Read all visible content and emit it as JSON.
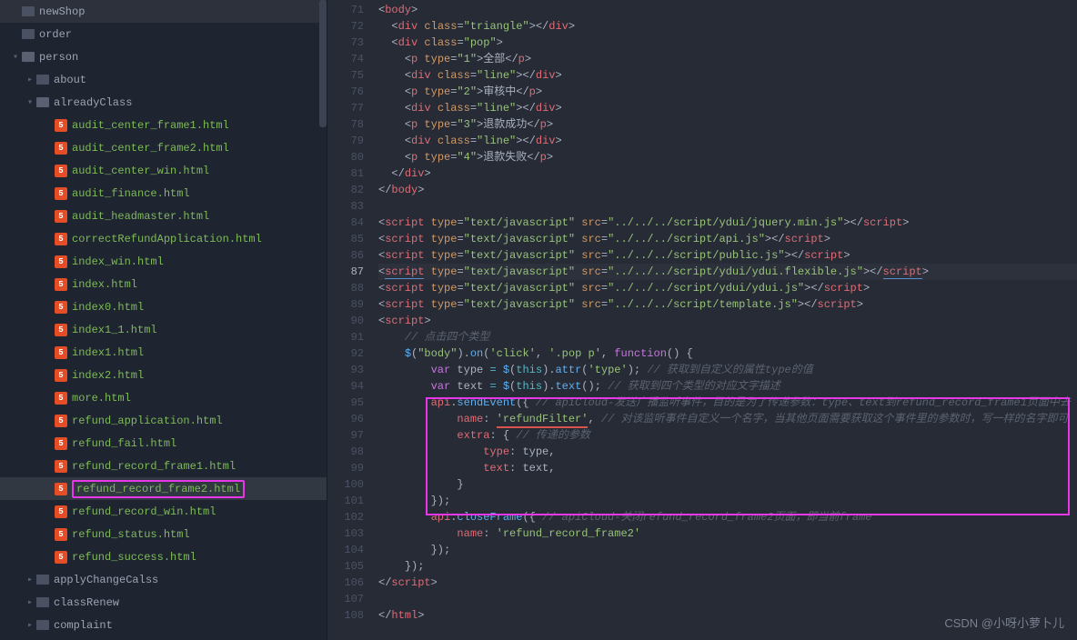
{
  "sidebar": {
    "items": [
      {
        "indent": 12,
        "chev": "",
        "icon": "folder",
        "label": "newShop",
        "class": ""
      },
      {
        "indent": 12,
        "chev": "",
        "icon": "folder",
        "label": "order",
        "class": ""
      },
      {
        "indent": 12,
        "chev": "▾",
        "icon": "folder-open",
        "label": "person",
        "class": ""
      },
      {
        "indent": 28,
        "chev": "▸",
        "icon": "folder",
        "label": "about",
        "class": ""
      },
      {
        "indent": 28,
        "chev": "▾",
        "icon": "folder-open",
        "label": "alreadyClass",
        "class": ""
      },
      {
        "indent": 48,
        "chev": "",
        "icon": "html",
        "label": "audit_center_frame1.html",
        "class": "green-name"
      },
      {
        "indent": 48,
        "chev": "",
        "icon": "html",
        "label": "audit_center_frame2.html",
        "class": "green-name"
      },
      {
        "indent": 48,
        "chev": "",
        "icon": "html",
        "label": "audit_center_win.html",
        "class": "green-name"
      },
      {
        "indent": 48,
        "chev": "",
        "icon": "html",
        "label": "audit_finance.html",
        "class": "green-name"
      },
      {
        "indent": 48,
        "chev": "",
        "icon": "html",
        "label": "audit_headmaster.html",
        "class": "green-name"
      },
      {
        "indent": 48,
        "chev": "",
        "icon": "html",
        "label": "correctRefundApplication.html",
        "class": "green-name"
      },
      {
        "indent": 48,
        "chev": "",
        "icon": "html",
        "label": "index_win.html",
        "class": "green-name"
      },
      {
        "indent": 48,
        "chev": "",
        "icon": "html",
        "label": "index.html",
        "class": "green-name"
      },
      {
        "indent": 48,
        "chev": "",
        "icon": "html",
        "label": "index0.html",
        "class": "green-name"
      },
      {
        "indent": 48,
        "chev": "",
        "icon": "html",
        "label": "index1_1.html",
        "class": "green-name"
      },
      {
        "indent": 48,
        "chev": "",
        "icon": "html",
        "label": "index1.html",
        "class": "green-name"
      },
      {
        "indent": 48,
        "chev": "",
        "icon": "html",
        "label": "index2.html",
        "class": "green-name"
      },
      {
        "indent": 48,
        "chev": "",
        "icon": "html",
        "label": "more.html",
        "class": "green-name"
      },
      {
        "indent": 48,
        "chev": "",
        "icon": "html",
        "label": "refund_application.html",
        "class": "green-name"
      },
      {
        "indent": 48,
        "chev": "",
        "icon": "html",
        "label": "refund_fail.html",
        "class": "green-name"
      },
      {
        "indent": 48,
        "chev": "",
        "icon": "html",
        "label": "refund_record_frame1.html",
        "class": "green-name"
      },
      {
        "indent": 48,
        "chev": "",
        "icon": "html",
        "label": "refund_record_frame2.html",
        "class": "green-name highlighted",
        "selected": true
      },
      {
        "indent": 48,
        "chev": "",
        "icon": "html",
        "label": "refund_record_win.html",
        "class": "green-name"
      },
      {
        "indent": 48,
        "chev": "",
        "icon": "html",
        "label": "refund_status.html",
        "class": "green-name"
      },
      {
        "indent": 48,
        "chev": "",
        "icon": "html",
        "label": "refund_success.html",
        "class": "green-name"
      },
      {
        "indent": 28,
        "chev": "▸",
        "icon": "folder",
        "label": "applyChangeCalss",
        "class": ""
      },
      {
        "indent": 28,
        "chev": "▸",
        "icon": "folder",
        "label": "classRenew",
        "class": ""
      },
      {
        "indent": 28,
        "chev": "▸",
        "icon": "folder",
        "label": "complaint",
        "class": ""
      }
    ]
  },
  "gutter": {
    "start": 71,
    "end": 108,
    "active": 87
  },
  "code": {
    "line71": {
      "tag": "body"
    },
    "line72": {
      "tag": "div",
      "attr": "class",
      "val": "triangle"
    },
    "line73": {
      "tag": "div",
      "attr": "class",
      "val": "pop"
    },
    "line74": {
      "tag": "p",
      "attr": "type",
      "val": "1",
      "text": "全部"
    },
    "line75": {
      "tag": "div",
      "attr": "class",
      "val": "line"
    },
    "line76": {
      "tag": "p",
      "attr": "type",
      "val": "2",
      "text": "审核中"
    },
    "line77": {
      "tag": "div",
      "attr": "class",
      "val": "line"
    },
    "line78": {
      "tag": "p",
      "attr": "type",
      "val": "3",
      "text": "退款成功"
    },
    "line79": {
      "tag": "div",
      "attr": "class",
      "val": "line"
    },
    "line80": {
      "tag": "p",
      "attr": "type",
      "val": "4",
      "text": "退款失败"
    },
    "line84": {
      "type": "text/javascript",
      "src": "../../../script/ydui/jquery.min.js"
    },
    "line85": {
      "type": "text/javascript",
      "src": "../../../script/api.js"
    },
    "line86": {
      "type": "text/javascript",
      "src": "../../../script/public.js"
    },
    "line87": {
      "type": "text/javascript",
      "src": "../../../script/ydui/ydui.flexible.js"
    },
    "line88": {
      "type": "text/javascript",
      "src": "../../../script/ydui/ydui.js"
    },
    "line89": {
      "type": "text/javascript",
      "src": "../../../script/template.js"
    },
    "line91_comment": "// 点击四个类型",
    "line92": {
      "sel1": "body",
      "ev": "click",
      "sel2": ".pop p"
    },
    "line93": {
      "v": "type",
      "m": "attr",
      "a": "type",
      "c": "// 获取到自定义的属性type的值"
    },
    "line94": {
      "v": "text",
      "m": "text",
      "c": "// 获取到四个类型的对应文字描述"
    },
    "line95": {
      "c": "// apiCloud-发送广播监听事件，目的是为了传递参数：type、text到refund_record_frame1页面中去"
    },
    "line96": {
      "val": "refundFilter",
      "c": "// 对该监听事件自定义一个名字，当其他页面需要获取这个事件里的参数时，写一样的名字即可"
    },
    "line97_comment": "// 传递的参数",
    "line98": "type: type,",
    "line99": "text: text,",
    "line102": {
      "c": "// apiCloud-关闭refund_record_frame2页面，即当前frame"
    },
    "line103": {
      "val": "refund_record_frame2"
    }
  },
  "watermark": "CSDN @小呀小萝卜儿"
}
